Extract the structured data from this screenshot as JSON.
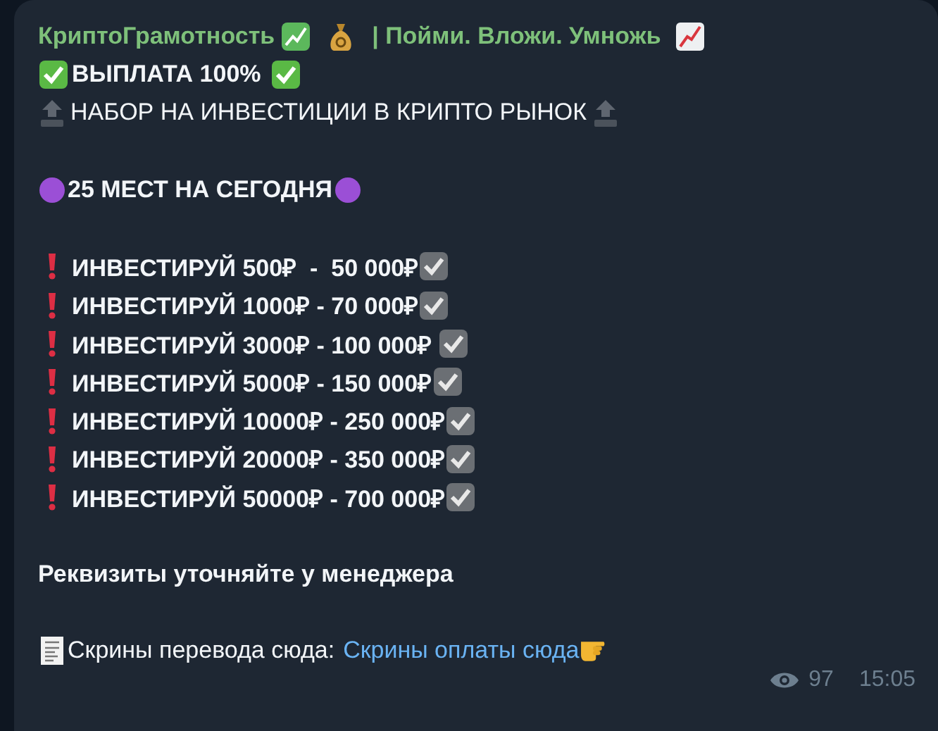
{
  "channel": {
    "name": "КриптоГрамотность",
    "tagline": "| Пойми. Вложи. Умножь"
  },
  "payout": "ВЫПЛАТА 100%",
  "recruitment": "НАБОР НА ИНВЕСТИЦИИ В КРИПТО РЫНОК",
  "spots": "25 МЕСТ НА СЕГОДНЯ",
  "offers": [
    "ИНВЕСТИРУЙ 500₽  -  50 000₽",
    "ИНВЕСТИРУЙ 1000₽ - 70 000₽",
    "ИНВЕСТИРУЙ 3000₽ - 100 000₽ ",
    "ИНВЕСТИРУЙ 5000₽ - 150 000₽",
    "ИНВЕСТИРУЙ 10000₽ - 250 000₽",
    "ИНВЕСТИРУЙ 20000₽ - 350 000₽",
    "ИНВЕСТИРУЙ 50000₽ - 700 000₽"
  ],
  "details_note": "Реквизиты уточняйте у менеджера",
  "screens": {
    "text": "Скрины перевода сюда:",
    "link": "Скрины оплаты сюда"
  },
  "footer": {
    "views": "97",
    "time": "15:05"
  }
}
